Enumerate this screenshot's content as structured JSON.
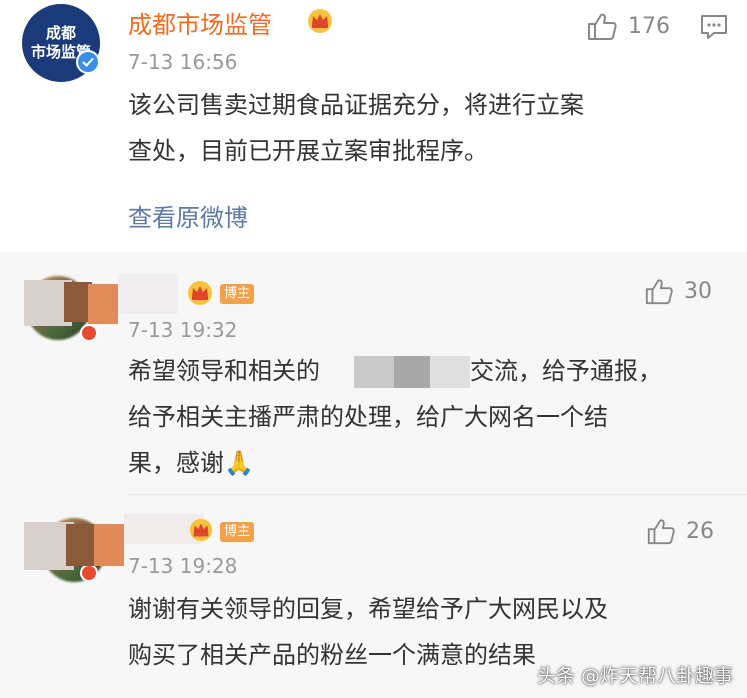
{
  "post": {
    "avatar_line1": "成都",
    "avatar_line2": "市场监管",
    "author": "成都市场监管",
    "time": "7-13 16:56",
    "like_count": "176",
    "text_line1": "该公司售卖过期食品证据充分，将进行立案",
    "text_line2": "查处，目前已开展立案审批程序。",
    "view_original": "查看原微博"
  },
  "comments": [
    {
      "badge": "博主",
      "time": "7-13 19:32",
      "likes": "30",
      "text_line1_a": "希望领导和相关的",
      "text_line1_b": "交流，给予通报，",
      "text_line2": "给予相关主播严肃的处理，给广大网名一个结",
      "text_line3": "果，感谢🙏"
    },
    {
      "badge": "博主",
      "time": "7-13 19:28",
      "likes": "26",
      "text_line1": "谢谢有关领导的回复，希望给予广大网民以及",
      "text_line2": "购买了相关产品的粉丝一个满意的结果"
    }
  ],
  "watermark": "头条 @炸天帮八卦趣事",
  "colors": {
    "author_name": "#f26c1f",
    "link": "#5b7aa6",
    "badge": "#f3a04a",
    "verified": "#3b8ee8"
  }
}
